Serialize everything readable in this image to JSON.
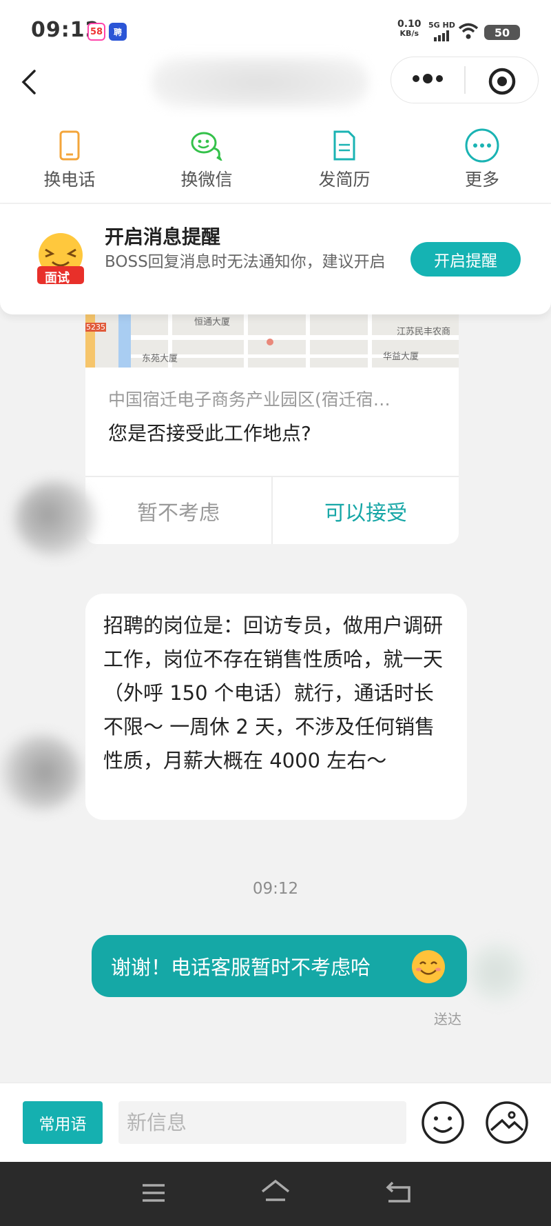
{
  "status_bar": {
    "time": "09:12",
    "badge_58": "58",
    "badge_zhao": "聘",
    "net_speed_value": "0.10",
    "net_speed_unit": "KB/s",
    "network": "5G HD",
    "battery": "50"
  },
  "action_bar": {
    "items": [
      {
        "label": "换电话",
        "icon": "phone-icon",
        "color": "#f3a53b"
      },
      {
        "label": "换微信",
        "icon": "wechat-icon",
        "color": "#34c14a"
      },
      {
        "label": "发简历",
        "icon": "resume-icon",
        "color": "#1ab3b3"
      },
      {
        "label": "更多",
        "icon": "more-icon",
        "color": "#1ab3b3"
      }
    ]
  },
  "notify": {
    "emoji_label": "面试",
    "title": "开启消息提醒",
    "desc": "BOSS回复消息时无法通知你，建议开启",
    "button": "开启提醒"
  },
  "map_card": {
    "labels": [
      "5235",
      "恒通大厦",
      "江苏民丰农商",
      "东苑大厦",
      "华益大厦"
    ],
    "address": "中国宿迁电子商务产业园区(宿迁宿…",
    "question": "您是否接受此工作地点?",
    "decline": "暂不考虑",
    "accept": "可以接受"
  },
  "messages": {
    "incoming_text": "招聘的岗位是：回访专员，做用户调研工作，岗位不存在销售性质哈，就一天（外呼 150 个电话）就行，通话时长不限～ 一周休 2 天，不涉及任何销售性质，月薪大概在 4000 左右～",
    "time": "09:12",
    "outgoing_text": "谢谢！电话客服暂时不考虑哈",
    "outgoing_status": "送达"
  },
  "input_bar": {
    "phrases_button": "常用语",
    "placeholder": "新信息"
  },
  "colors": {
    "accent": "#15b0b0",
    "outgoing_bubble": "#15a8a6"
  }
}
